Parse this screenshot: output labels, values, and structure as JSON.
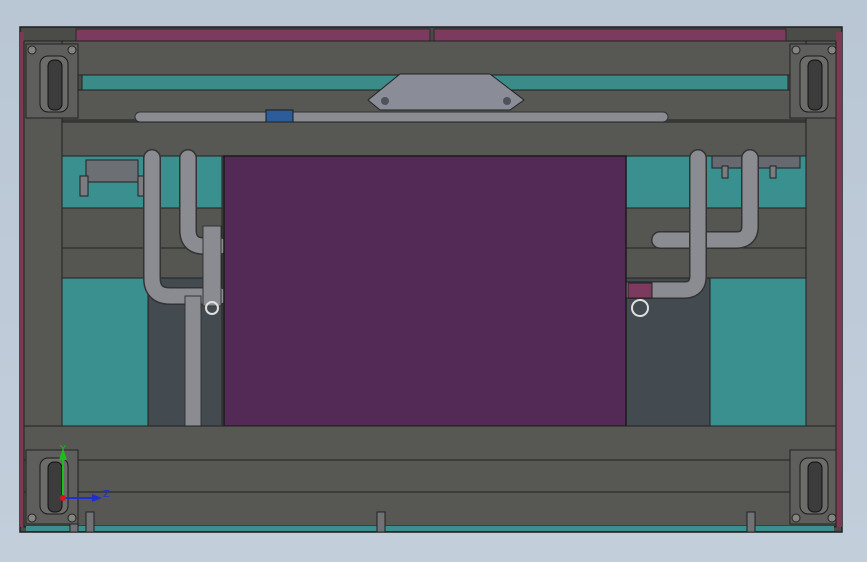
{
  "view": {
    "background_top": "#b9c6d4",
    "background_bottom": "#c3cedb",
    "frame_color": "#565652",
    "panel_color": "#522a55",
    "teal_color": "#3a8f8f",
    "pipe_color": "#8a8c92"
  },
  "triad": {
    "y_label": "Y",
    "z_label": "Z",
    "y_color": "#18c018",
    "z_color": "#2030d0",
    "x_color": "#d01818"
  }
}
